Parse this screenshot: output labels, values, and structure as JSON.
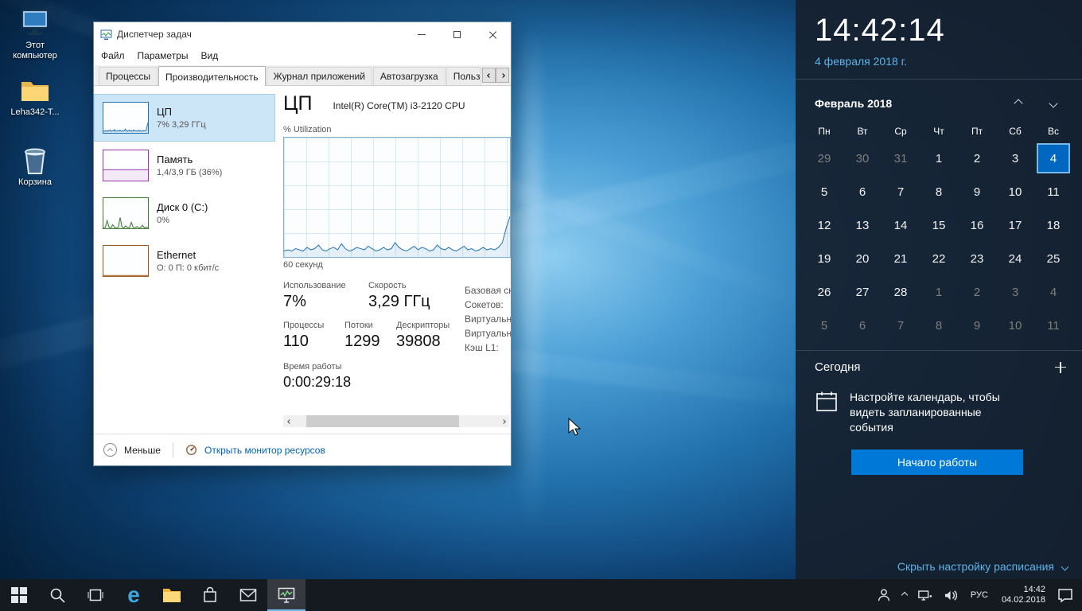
{
  "colors": {
    "accent": "#0078d7",
    "tm_link": "#0063b1",
    "flyout_link": "#5eb2e8",
    "chart_blue": "#2273b5",
    "memory_purple": "#9b34b5",
    "disk_green": "#3f7a34",
    "network_brown": "#a05a1c"
  },
  "desktop": {
    "icons": [
      {
        "label": "Этот компьютер"
      },
      {
        "label": "Leha342-T..."
      },
      {
        "label": "Корзина"
      }
    ]
  },
  "task_manager": {
    "title": "Диспетчер задач",
    "menu": [
      "Файл",
      "Параметры",
      "Вид"
    ],
    "tabs": [
      "Процессы",
      "Производительность",
      "Журнал приложений",
      "Автозагрузка",
      "Пользователи"
    ],
    "active_tab": "Производительность",
    "sidebar": [
      {
        "title": "ЦП",
        "subtitle": "7% 3,29 ГГц"
      },
      {
        "title": "Память",
        "subtitle": "1,4/3,9 ГБ (36%)"
      },
      {
        "title": "Диск 0 (C:)",
        "subtitle": "0%"
      },
      {
        "title": "Ethernet",
        "subtitle": "О: 0 П: 0 кбит/с"
      }
    ],
    "details": {
      "title": "ЦП",
      "subtitle": "Intel(R) Core(TM) i3-2120 CPU",
      "graph_label": "% Utilization",
      "x_axis": "60 секунд",
      "stats_row1": [
        {
          "label": "Использование",
          "value": "7%"
        },
        {
          "label": "Скорость",
          "value": "3,29 ГГц"
        }
      ],
      "stats_row2": [
        {
          "label": "Процессы",
          "value": "110"
        },
        {
          "label": "Потоки",
          "value": "1299"
        },
        {
          "label": "Дескрипторы",
          "value": "39808"
        }
      ],
      "uptime": {
        "label": "Время работы",
        "value": "0:00:29:18"
      },
      "right_labels": [
        "Базовая ск",
        "Сокетов:",
        "Виртуальн",
        "Виртуальн",
        "Кэш L1:"
      ]
    },
    "footer": {
      "less": "Меньше",
      "resource_link": "Открыть монитор ресурсов"
    }
  },
  "charts": {
    "cpu_main": [
      5,
      6,
      5,
      7,
      6,
      5,
      8,
      6,
      7,
      10,
      6,
      5,
      7,
      8,
      6,
      11,
      7,
      5,
      6,
      8,
      7,
      6,
      9,
      7,
      5,
      6,
      8,
      6,
      7,
      12,
      8,
      6,
      5,
      7,
      9,
      6,
      8,
      7,
      5,
      6,
      10,
      7,
      6,
      8,
      6,
      5,
      7,
      9,
      6,
      7,
      5,
      6,
      8,
      6,
      7,
      6,
      8,
      12,
      24,
      34
    ],
    "memory_mini": [
      36,
      36,
      36,
      36,
      36,
      36,
      36,
      36,
      36,
      36
    ],
    "disk_mini": [
      2,
      3,
      26,
      4,
      2,
      12,
      3,
      2,
      3,
      36,
      5,
      2,
      8,
      3,
      2,
      20,
      4,
      2,
      6,
      2,
      3,
      10,
      2,
      4,
      2
    ],
    "ethernet_mini": [
      2,
      2,
      2,
      2,
      2,
      2,
      2,
      2,
      2,
      2
    ]
  },
  "calendar_flyout": {
    "time": "14:42:14",
    "date": "4 февраля 2018 г.",
    "month": "Февраль 2018",
    "weekdays": [
      "Пн",
      "Вт",
      "Ср",
      "Чт",
      "Пт",
      "Сб",
      "Вс"
    ],
    "days": [
      {
        "d": "29",
        "muted": true
      },
      {
        "d": "30",
        "muted": true
      },
      {
        "d": "31",
        "muted": true
      },
      {
        "d": "1"
      },
      {
        "d": "2"
      },
      {
        "d": "3"
      },
      {
        "d": "4",
        "today": true
      },
      {
        "d": "5"
      },
      {
        "d": "6"
      },
      {
        "d": "7"
      },
      {
        "d": "8"
      },
      {
        "d": "9"
      },
      {
        "d": "10"
      },
      {
        "d": "11"
      },
      {
        "d": "12"
      },
      {
        "d": "13"
      },
      {
        "d": "14"
      },
      {
        "d": "15"
      },
      {
        "d": "16"
      },
      {
        "d": "17"
      },
      {
        "d": "18"
      },
      {
        "d": "19"
      },
      {
        "d": "20"
      },
      {
        "d": "21"
      },
      {
        "d": "22"
      },
      {
        "d": "23"
      },
      {
        "d": "24"
      },
      {
        "d": "25"
      },
      {
        "d": "26"
      },
      {
        "d": "27"
      },
      {
        "d": "28"
      },
      {
        "d": "1",
        "muted": true
      },
      {
        "d": "2",
        "muted": true
      },
      {
        "d": "3",
        "muted": true
      },
      {
        "d": "4",
        "muted": true
      },
      {
        "d": "5",
        "muted": true
      },
      {
        "d": "6",
        "muted": true
      },
      {
        "d": "7",
        "muted": true
      },
      {
        "d": "8",
        "muted": true
      },
      {
        "d": "9",
        "muted": true
      },
      {
        "d": "10",
        "muted": true
      },
      {
        "d": "11",
        "muted": true
      }
    ],
    "today_label": "Сегодня",
    "event_hint": "Настройте календарь, чтобы видеть запланированные события",
    "button": "Начало работы",
    "hide_link": "Скрыть настройку расписания"
  },
  "taskbar": {
    "language": "РУС",
    "time": "14:42",
    "date": "04.02.2018"
  }
}
